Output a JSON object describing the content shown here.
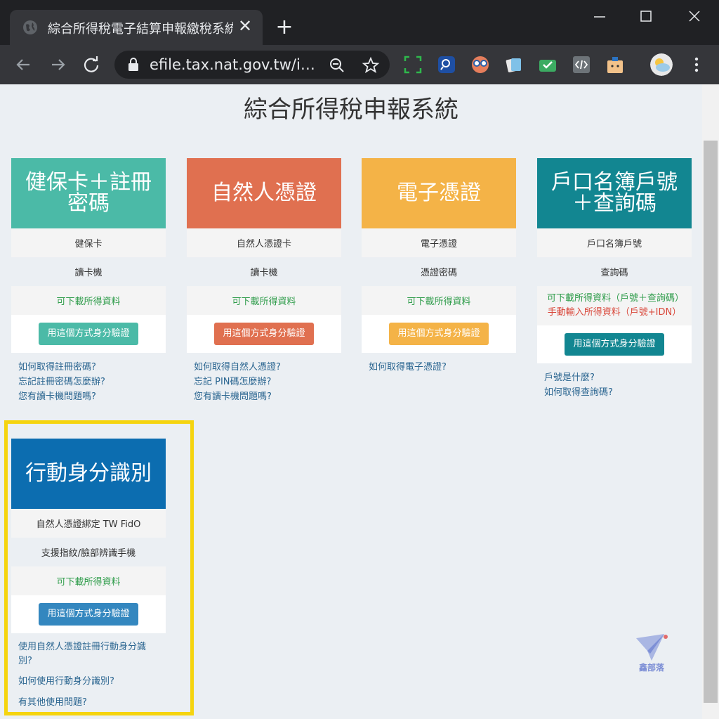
{
  "browser": {
    "tab_title": "綜合所得稅電子結算申報繳稅系統",
    "tab_close": "✕",
    "new_tab": "+",
    "url": "efile.tax.nat.gov.tw/irx..."
  },
  "page": {
    "title": "綜合所得稅申報系統",
    "cards": [
      {
        "title": "健保卡＋註冊密碼",
        "color": "#4bbaa7",
        "rows": [
          "健保卡",
          "讀卡機"
        ],
        "download": "可下載所得資料",
        "button": "用這個方式身分驗證",
        "links": [
          "如何取得註冊密碼?",
          "忘記註冊密碼怎麼辦?",
          "您有讀卡機問題嗎?"
        ]
      },
      {
        "title": "自然人憑證",
        "color": "#e07050",
        "rows": [
          "自然人憑證卡",
          "讀卡機"
        ],
        "download": "可下載所得資料",
        "button": "用這個方式身分驗證",
        "links": [
          "如何取得自然人憑證?",
          "忘記 PIN碼怎麼辦?",
          "您有讀卡機問題嗎?"
        ]
      },
      {
        "title": "電子憑證",
        "color": "#f4b347",
        "rows": [
          "電子憑證",
          "憑證密碼"
        ],
        "download": "可下載所得資料",
        "button": "用這個方式身分驗證",
        "links": [
          "如何取得電子憑證?"
        ]
      },
      {
        "title": "戶口名簿戶號＋查詢碼",
        "color": "#128691",
        "rows": [
          "戶口名簿戶號",
          "查詢碼"
        ],
        "download": "可下載所得資料（戶號＋查詢碼）",
        "manual": "手動輸入所得資料（戶號+IDN）",
        "button": "用這個方式身分驗證",
        "links": [
          "戶號是什麼?",
          "如何取得查詢碼?"
        ]
      },
      {
        "title": "行動身分識別",
        "color": "#0c6db0",
        "button_color": "#3487bf",
        "rows": [
          "自然人憑證綁定 TW FidO",
          "支援指紋/臉部辨識手機"
        ],
        "download": "可下載所得資料",
        "button": "用這個方式身分驗證",
        "links": [
          "使用自然人憑證註冊行動身分識別?",
          "如何使用行動身分識別?",
          "有其他使用問題?"
        ]
      }
    ],
    "watermark_label": "鑫部落"
  }
}
